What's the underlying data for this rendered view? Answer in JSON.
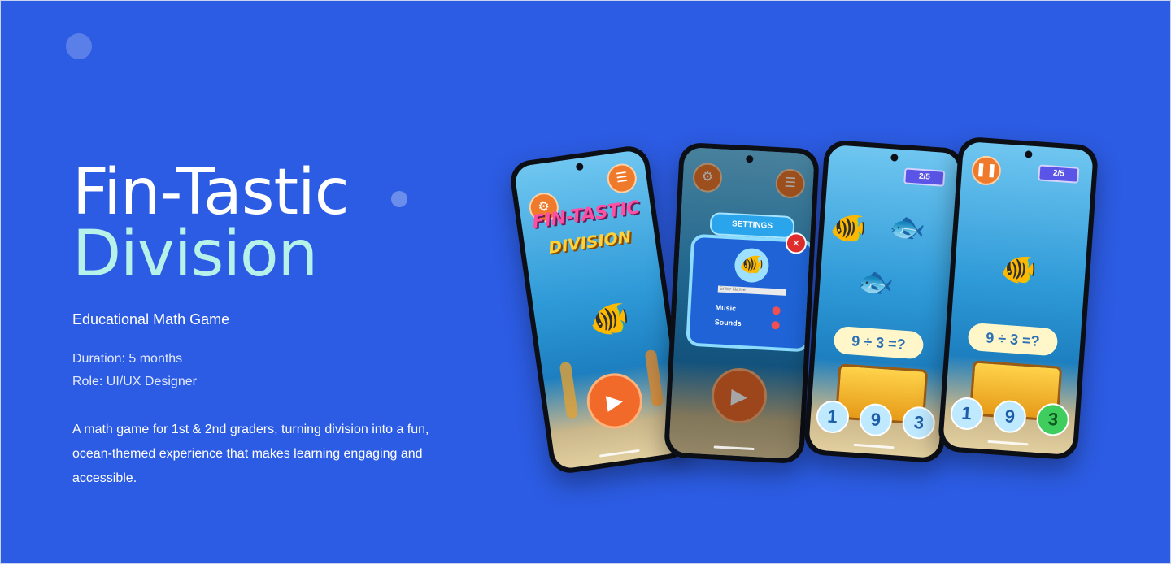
{
  "hero": {
    "title_line1": "Fin-Tastic",
    "title_line2": "Division",
    "subtitle": "Educational Math Game",
    "duration": "Duration: 5 months",
    "role": "Role: UI/UX Designer",
    "description": "A math game for 1st & 2nd graders, turning division into a fun, ocean-themed experience that makes learning engaging and accessible."
  },
  "colors": {
    "background": "#2c5ce3",
    "title_accent": "#b7f2ea",
    "button_orange": "#f07a2c"
  },
  "phone1": {
    "title_top": "FIN-TASTIC",
    "title_bottom": "DIVISION",
    "play_icon": "play-icon"
  },
  "phone2": {
    "settings_title": "SETTINGS",
    "name_placeholder": "Enter Name",
    "music_label": "Music",
    "sounds_label": "Sounds"
  },
  "phone3": {
    "progress": "2/5",
    "question": "9 ÷ 3 =?",
    "answers": [
      "1",
      "9",
      "3"
    ]
  },
  "phone4": {
    "progress": "2/5",
    "question": "9 ÷ 3 =?",
    "answers": [
      "1",
      "9",
      "3"
    ]
  }
}
